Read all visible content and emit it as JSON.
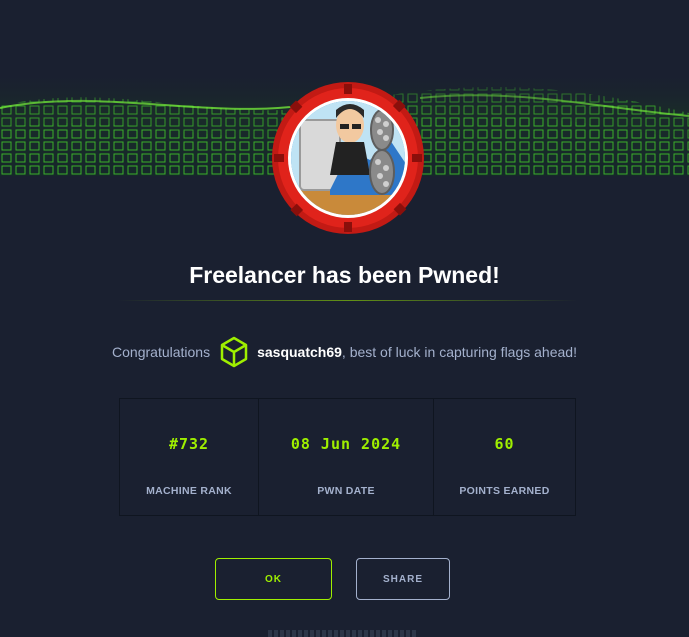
{
  "machine": {
    "name": "Freelancer"
  },
  "title": "Freelancer has been Pwned!",
  "congrats": {
    "prefix": "Congratulations",
    "username": "sasquatch69",
    "suffix": ", best of luck in capturing flags ahead!"
  },
  "stats": [
    {
      "value": "#732",
      "label": "MACHINE RANK"
    },
    {
      "value": "08 Jun 2024",
      "label": "PWN DATE"
    },
    {
      "value": "60",
      "label": "POINTS EARNED"
    }
  ],
  "buttons": {
    "ok": "OK",
    "share": "SHARE"
  },
  "colors": {
    "accent": "#9fef00",
    "background": "#1a2030",
    "text_muted": "#a4b1cd",
    "ring": "#e0231b"
  },
  "icons": {
    "user_badge": "hexagon-cube-icon"
  }
}
